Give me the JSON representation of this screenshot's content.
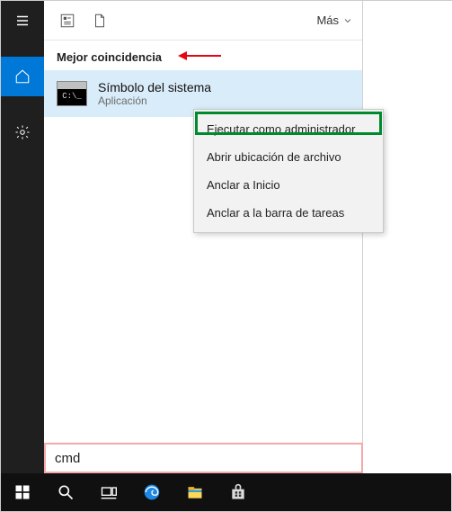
{
  "top": {
    "more_label": "Más"
  },
  "section": {
    "header": "Mejor coincidencia"
  },
  "result": {
    "title": "Símbolo del sistema",
    "subtitle": "Aplicación",
    "thumb_text": "C:\\_"
  },
  "context_menu": {
    "items": [
      "Ejecutar como administrador",
      "Abrir ubicación de archivo",
      "Anclar a Inicio",
      "Anclar a la barra de tareas"
    ]
  },
  "search": {
    "value": "cmd"
  },
  "annotation": {
    "arrow_color": "#e30613",
    "highlight_box_color": "#008a2e",
    "search_outline_color": "#f4a9a9"
  }
}
